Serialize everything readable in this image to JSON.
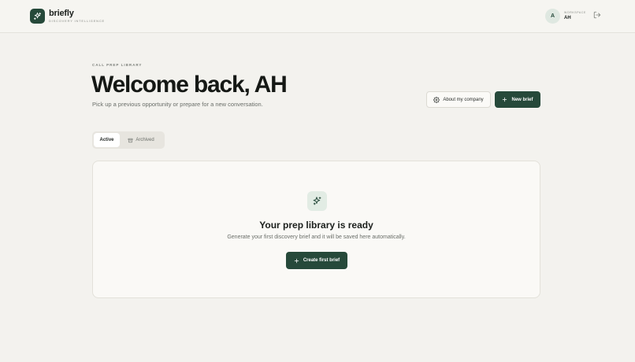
{
  "header": {
    "brand_name": "briefly",
    "brand_tagline": "DISCOVERY INTELLIGENCE",
    "logo_icon": "sparkle-icon",
    "avatar_initial": "A",
    "workspace_label": "WORKSPACE",
    "workspace_value": "AH",
    "logout_icon": "logout-icon"
  },
  "main": {
    "eyebrow": "CALL PREP LIBRARY",
    "title": "Welcome back, AH",
    "subtitle": "Pick up a previous opportunity or prepare for a new conversation.",
    "about_button_label": "About my company",
    "about_button_icon": "gear-icon",
    "new_brief_label": "New brief",
    "new_brief_icon": "plus-icon"
  },
  "tabs": [
    {
      "label": "Active",
      "selected": true
    },
    {
      "label": "Archived",
      "selected": false,
      "icon": "archive-icon"
    }
  ],
  "empty_state": {
    "icon": "sparkle-icon",
    "title": "Your prep library is ready",
    "description": "Generate your first discovery brief and it will be saved here automatically.",
    "button_label": "Create first brief",
    "button_icon": "plus-icon"
  },
  "colors": {
    "accent": "#26493a",
    "background": "#f3f2ee",
    "card": "#faf9f6",
    "icon_tint": "#e2ece4"
  }
}
